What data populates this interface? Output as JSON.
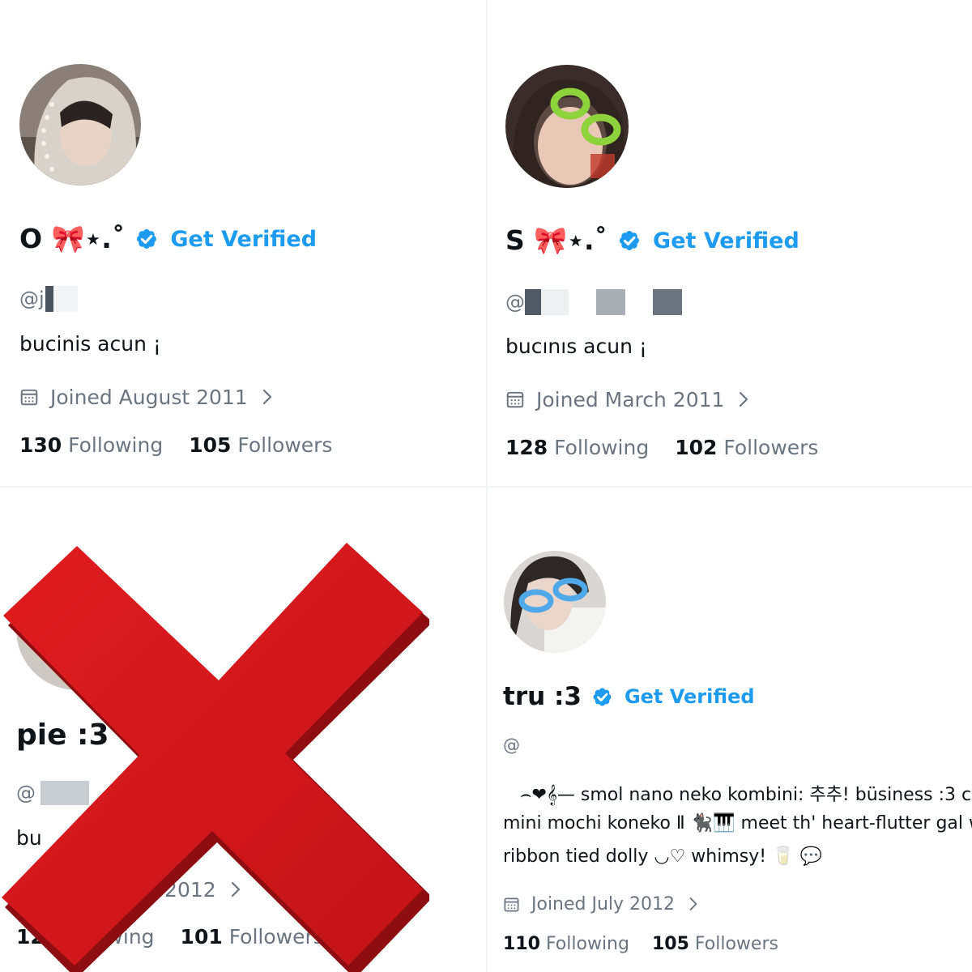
{
  "profiles": [
    {
      "name": "O 🎀⋆.˚",
      "get_verified": "Get Verified",
      "handle": "@j",
      "bio": "bucinis acun ¡",
      "joined": "Joined August 2011",
      "following_count": "130",
      "following_label": "Following",
      "followers_count": "105",
      "followers_label": "Followers"
    },
    {
      "name": "S 🎀⋆.˚",
      "get_verified": "Get Verified",
      "handle": "@",
      "bio": "bucınıs acun ¡",
      "joined": "Joined March 2011",
      "following_count": "128",
      "following_label": "Following",
      "followers_count": "102",
      "followers_label": "Followers"
    },
    {
      "name": "pie :3",
      "handle": "@",
      "bio": "bu",
      "joined": "ay 2012",
      "following_count": "122",
      "following_label": "owing",
      "followers_count": "101",
      "followers_label": "Followers"
    },
    {
      "name": "tru :3",
      "get_verified": "Get Verified",
      "handle": "@",
      "bio_line1": "⌢❤𝄞— smol nano neko kombini: 추추! büsiness :3 c",
      "bio_line2": "mini mochi koneko Ⅱ 🐈‍⬛🎹 meet th' heart-flutter gal w",
      "bio_line3": "ribbon tied dolly ◡♡ whimsy! 🥛 💬",
      "joined": "Joined July 2012",
      "following_count": "110",
      "following_label": "Following",
      "followers_count": "105",
      "followers_label": "Followers"
    }
  ],
  "overlay": {
    "icon": "red-x-mark",
    "color": "#d0161b"
  },
  "colors": {
    "accent": "#1d9bf0",
    "muted": "#6b7580",
    "text": "#0f1419"
  }
}
